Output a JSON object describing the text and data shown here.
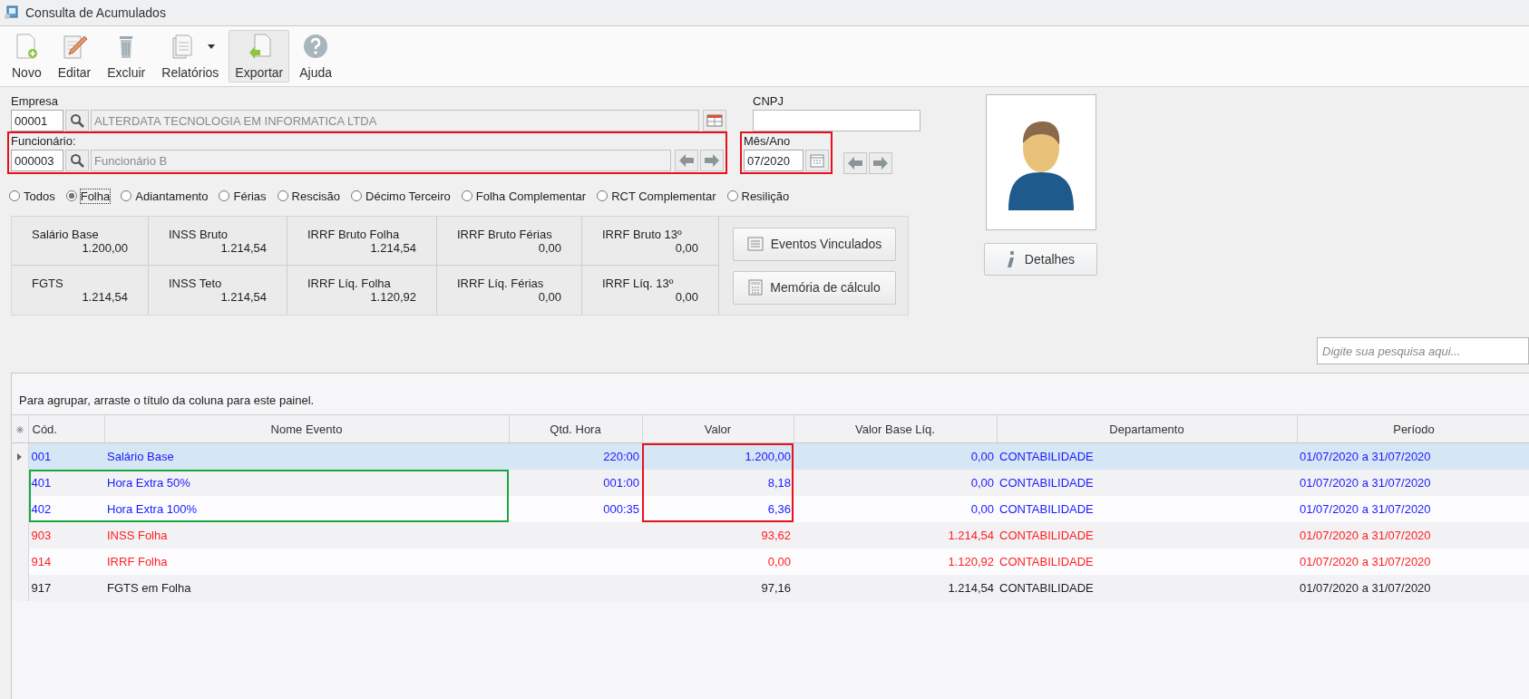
{
  "window": {
    "title": "Consulta de Acumulados"
  },
  "toolbar": [
    {
      "label": "Novo",
      "kind": "new",
      "pressed": false,
      "has_menu": false
    },
    {
      "label": "Editar",
      "kind": "edit",
      "pressed": false,
      "has_menu": false
    },
    {
      "label": "Excluir",
      "kind": "delete",
      "pressed": false,
      "has_menu": false
    },
    {
      "label": "Relatórios",
      "kind": "report",
      "pressed": false,
      "has_menu": true
    },
    {
      "label": "Exportar",
      "kind": "export",
      "pressed": true,
      "has_menu": false
    },
    {
      "label": "Ajuda",
      "kind": "help",
      "pressed": false,
      "has_menu": false
    }
  ],
  "form": {
    "empresa": {
      "label": "Empresa",
      "code": "00001",
      "name": "ALTERDATA TECNOLOGIA EM INFORMATICA LTDA"
    },
    "cnpj": {
      "label": "CNPJ"
    },
    "funcionario": {
      "label": "Funcionário:",
      "code": "000003",
      "name": "Funcionário B",
      "highlighted": true
    },
    "mes_ano": {
      "label": "Mês/Ano",
      "value": "07/2020",
      "highlighted": true
    }
  },
  "filters": [
    {
      "label": "Todos",
      "selected": false
    },
    {
      "label": "Folha",
      "selected": true
    },
    {
      "label": "Adiantamento",
      "selected": false
    },
    {
      "label": "Férias",
      "selected": false
    },
    {
      "label": "Rescisão",
      "selected": false
    },
    {
      "label": "Décimo Terceiro",
      "selected": false
    },
    {
      "label": "Folha Complementar",
      "selected": false
    },
    {
      "label": "RCT Complementar",
      "selected": false
    },
    {
      "label": "Resilição",
      "selected": false
    }
  ],
  "totals": [
    {
      "label": "Salário Base",
      "value": "1.200,00"
    },
    {
      "label": "INSS Bruto",
      "value": "1.214,54"
    },
    {
      "label": "IRRF Bruto Folha",
      "value": "1.214,54"
    },
    {
      "label": "IRRF Bruto Férias",
      "value": "0,00"
    },
    {
      "label": "IRRF Bruto 13º",
      "value": "0,00"
    },
    {
      "label": "FGTS",
      "value": "1.214,54"
    },
    {
      "label": "INSS Teto",
      "value": "1.214,54"
    },
    {
      "label": "IRRF Líq. Folha",
      "value": "1.120,92"
    },
    {
      "label": "IRRF Líq. Férias",
      "value": "0,00"
    },
    {
      "label": "IRRF Líq. 13º",
      "value": "0,00"
    }
  ],
  "actions": [
    {
      "label": "Eventos Vinculados",
      "kind": "list"
    },
    {
      "label": "Memória de cálculo",
      "kind": "calculator"
    }
  ],
  "details_button": {
    "label": "Detalhes"
  },
  "search": {
    "placeholder": "Digite sua pesquisa aqui..."
  },
  "grid": {
    "group_hint": "Para agrupar, arraste o título da coluna para este painel.",
    "columns": [
      "Cód.",
      "Nome Evento",
      "Qtd. Hora",
      "Valor",
      "Valor Base Líq.",
      "Departamento",
      "Período"
    ],
    "rows": [
      {
        "cells": [
          "001",
          "Salário Base",
          "220:00",
          "1.200,00",
          "0,00",
          "CONTABILIDADE",
          "01/07/2020 a 31/07/2020"
        ],
        "color": "#1a1aff",
        "selected": true,
        "code_highlighted": false,
        "value_highlighted": true
      },
      {
        "cells": [
          "401",
          "Hora Extra 50%",
          "001:00",
          "8,18",
          "0,00",
          "CONTABILIDADE",
          "01/07/2020 a 31/07/2020"
        ],
        "color": "#1a1aff",
        "selected": false,
        "code_highlighted": true,
        "value_highlighted": true
      },
      {
        "cells": [
          "402",
          "Hora Extra 100%",
          "000:35",
          "6,36",
          "0,00",
          "CONTABILIDADE",
          "01/07/2020 a 31/07/2020"
        ],
        "color": "#1a1aff",
        "selected": false,
        "code_highlighted": true,
        "value_highlighted": true
      },
      {
        "cells": [
          "903",
          "INSS Folha",
          "",
          "93,62",
          "1.214,54",
          "CONTABILIDADE",
          "01/07/2020 a 31/07/2020"
        ],
        "color": "#ff2020",
        "selected": false,
        "code_highlighted": false,
        "value_highlighted": false
      },
      {
        "cells": [
          "914",
          "IRRF Folha",
          "",
          "0,00",
          "1.120,92",
          "CONTABILIDADE",
          "01/07/2020 a 31/07/2020"
        ],
        "color": "#ff2020",
        "selected": false,
        "code_highlighted": false,
        "value_highlighted": false
      },
      {
        "cells": [
          "917",
          "FGTS em Folha",
          "",
          "97,16",
          "1.214,54",
          "CONTABILIDADE",
          "01/07/2020 a 31/07/2020"
        ],
        "color": "#1e1e1e",
        "selected": false,
        "code_highlighted": false,
        "value_highlighted": false
      }
    ]
  }
}
